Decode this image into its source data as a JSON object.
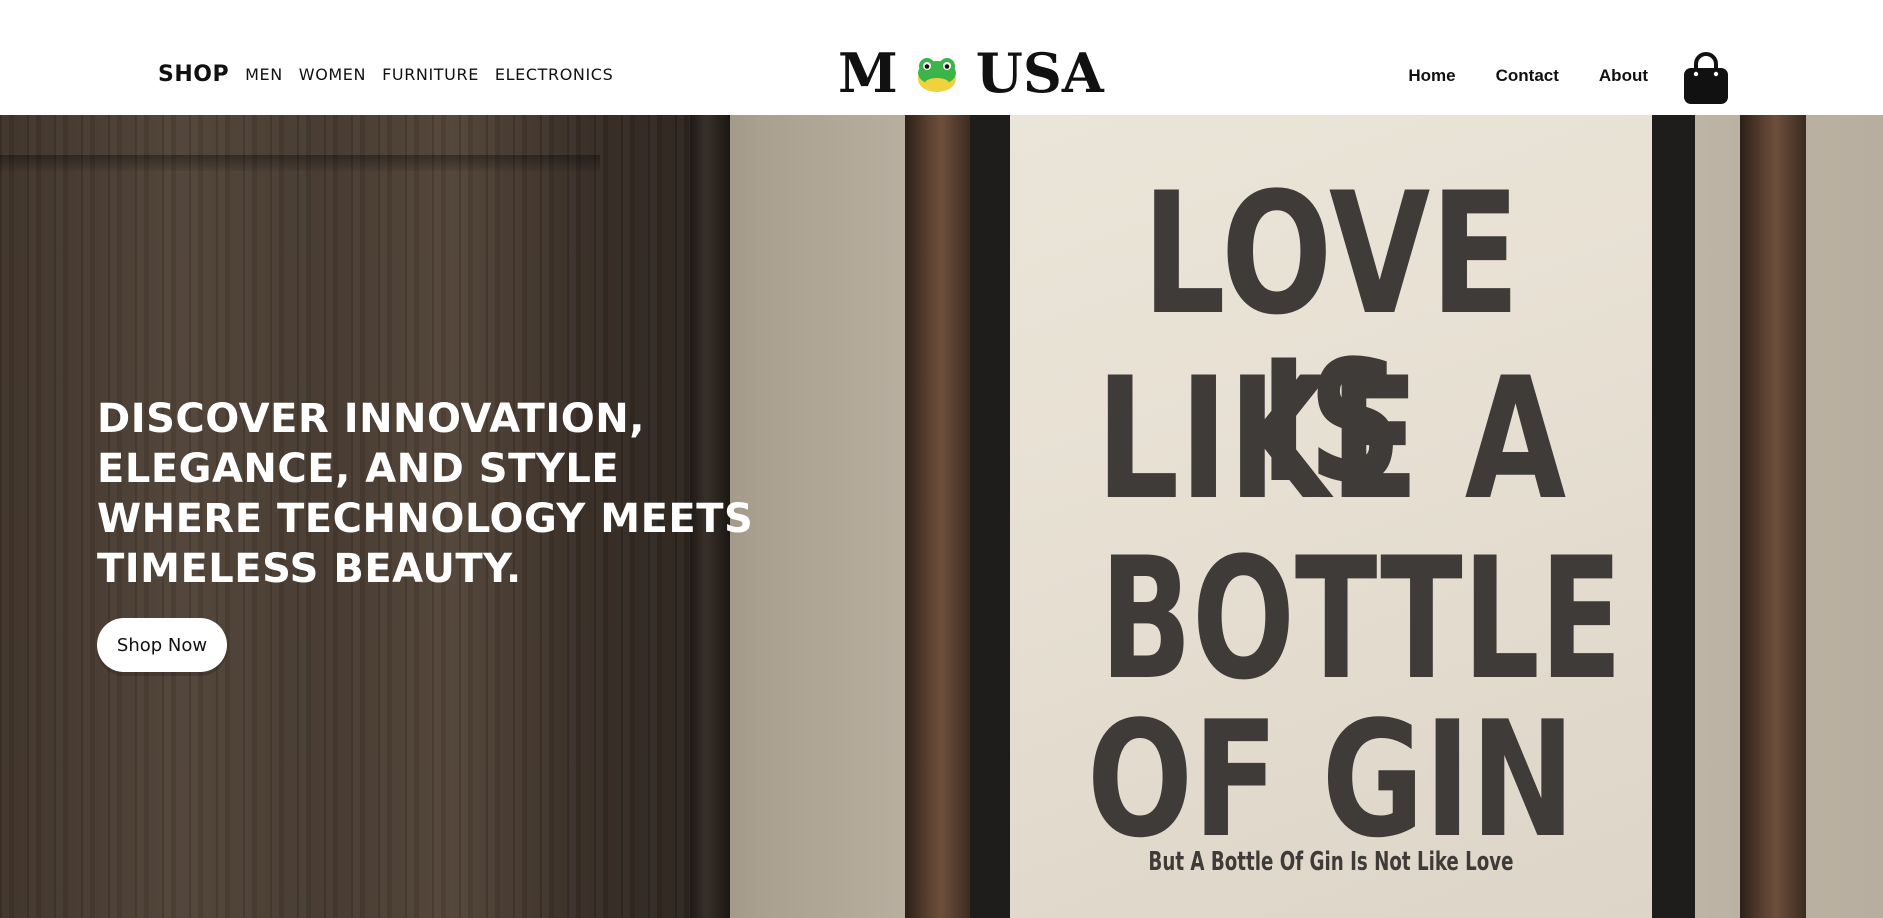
{
  "header": {
    "nav_left": {
      "shop": "SHOP",
      "categories": [
        "MEN",
        "WOMEN",
        "FURNITURE",
        "ELECTRONICS"
      ]
    },
    "logo": {
      "left": "M",
      "right": "USA",
      "icon": "frog-icon"
    },
    "nav_right": [
      "Home",
      "Contact",
      "About"
    ],
    "cart_icon": "shopping-bag-icon"
  },
  "hero": {
    "title_lines": [
      "DISCOVER INNOVATION,",
      "ELEGANCE, AND STYLE",
      "WHERE TECHNOLOGY MEETS",
      "TIMELESS BEAUTY."
    ],
    "cta_label": "Shop Now",
    "poster": {
      "lines": [
        "LOVE IS",
        "LIKE A",
        "BOTTLE",
        "OF GIN"
      ],
      "caption": "But A Bottle Of Gin Is Not Like Love"
    }
  },
  "colors": {
    "header_bg": "#ffffff",
    "text_dark": "#111111",
    "hero_text": "#ffffff",
    "button_bg": "#ffffff",
    "frog_green": "#3bb54a",
    "frog_yellow": "#f2d23c"
  }
}
